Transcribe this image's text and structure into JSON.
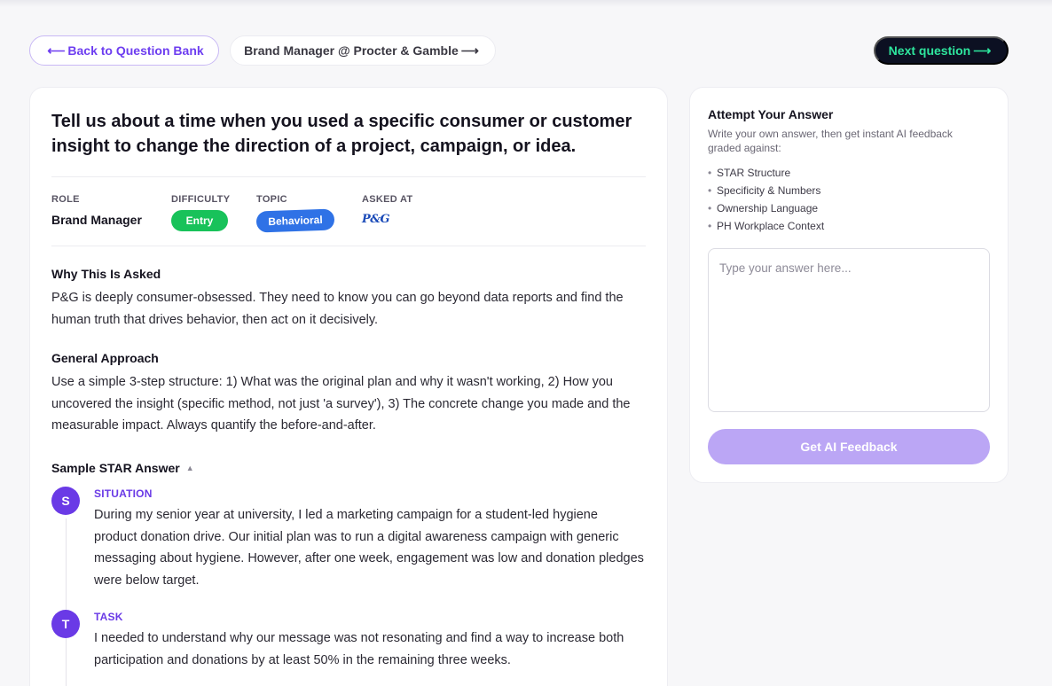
{
  "nav": {
    "back_label": "Back to Question Bank",
    "company_label": "Brand Manager @ Procter & Gamble",
    "next_label": "Next question",
    "arrow_left": "⟵",
    "arrow_right": "⟶"
  },
  "question": {
    "title": "Tell us about a time when you used a specific consumer or customer insight to change the direction of a project, campaign, or idea.",
    "meta": {
      "role_label": "ROLE",
      "role_value": "Brand Manager",
      "difficulty_label": "DIFFICULTY",
      "difficulty_value": "Entry",
      "topic_label": "TOPIC",
      "topic_value": "Behavioral",
      "asked_at_label": "ASKED AT",
      "asked_at_logo": "P&G"
    },
    "why_heading": "Why This Is Asked",
    "why_text": "P&G is deeply consumer-obsessed. They need to know you can go beyond data reports and find the human truth that drives behavior, then act on it decisively.",
    "approach_heading": "General Approach",
    "approach_text": "Use a simple 3-step structure: 1) What was the original plan and why it wasn't working, 2) How you uncovered the insight (specific method, not just 'a survey'), 3) The concrete change you made and the measurable impact. Always quantify the before-and-after.",
    "sample_heading": "Sample STAR Answer",
    "sample_caret": "▲",
    "steps": [
      {
        "letter": "S",
        "label": "SITUATION",
        "text": "During my senior year at university, I led a marketing campaign for a student-led hygiene product donation drive. Our initial plan was to run a digital awareness campaign with generic messaging about hygiene. However, after one week, engagement was low and donation pledges were below target."
      },
      {
        "letter": "T",
        "label": "TASK",
        "text": "I needed to understand why our message was not resonating and find a way to increase both participation and donations by at least 50% in the remaining three weeks."
      }
    ]
  },
  "attempt": {
    "title": "Attempt Your Answer",
    "subtitle": "Write your own answer, then get instant AI feedback graded against:",
    "criteria": [
      "STAR Structure",
      "Specificity & Numbers",
      "Ownership Language",
      "PH Workplace Context"
    ],
    "bullet": "•",
    "placeholder": "Type your answer here...",
    "button_label": "Get AI Feedback"
  },
  "colors": {
    "accent": "#6a3ae6",
    "next_bg": "#0c1022",
    "next_text": "#2ee59d",
    "entry_badge": "#18c25a",
    "topic_badge": "#2f72e6",
    "feedback_btn": "#bba6f5"
  }
}
